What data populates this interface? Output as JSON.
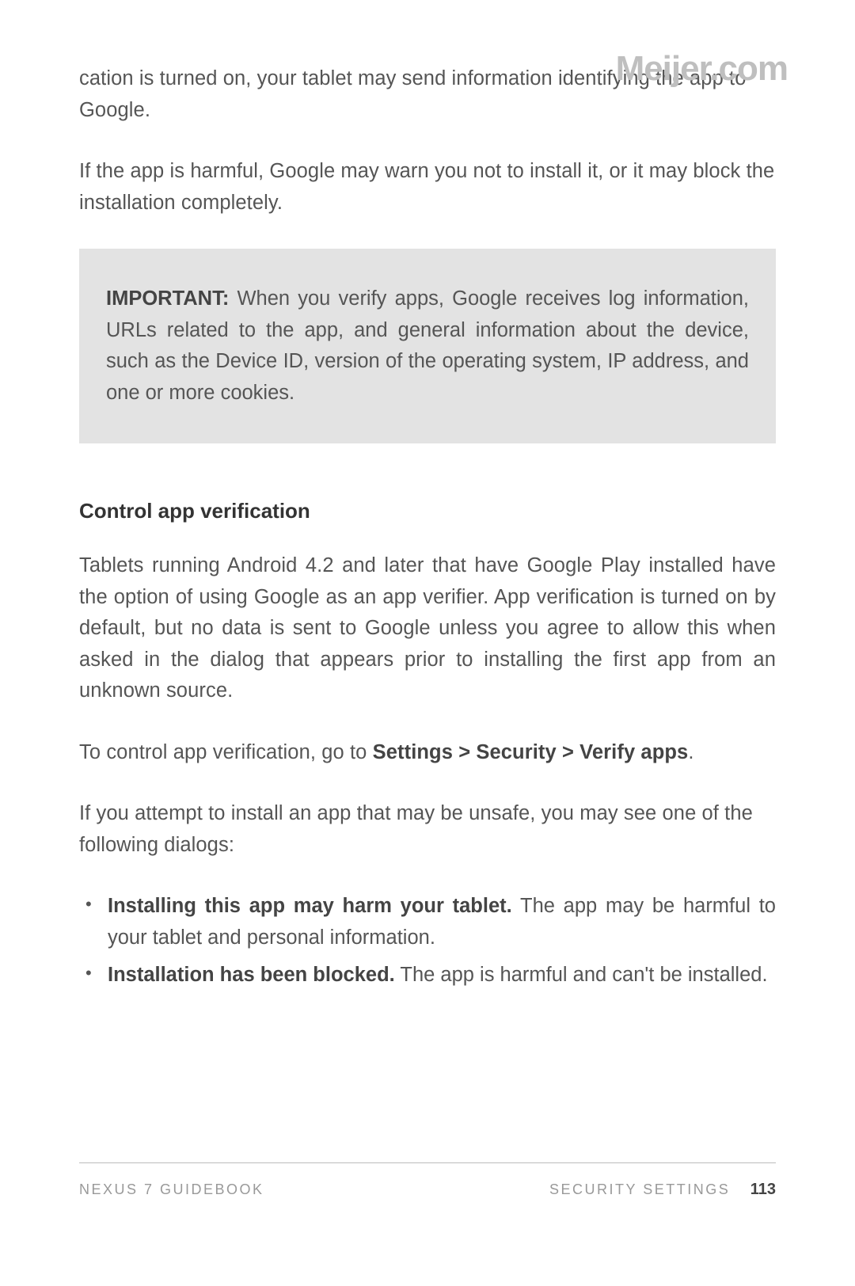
{
  "watermark": "Meijer.com",
  "intro_para1": "cation is turned on, your tablet may send information identifying the app to Google.",
  "intro_para2": "If the app is harmful, Google may warn you not to install it, or it may block the installation completely.",
  "callout_label": "IMPORTANT:",
  "callout_body": " When you verify apps, Google receives log information, URLs related to the app, and general information about the device, such as the Device ID, version of the operating system, IP address, and one or more cookies.",
  "section_heading": "Control app verification",
  "section_para1": "Tablets running Android 4.2 and later that have Google Play installed have the option of using Google as an app verifier. App verification is turned on by default, but no data is sent to Google unless you agree to allow this when asked in the dialog that appears prior to installing the first app from an unknown source.",
  "section_para2_pre": "To control app verification, go to ",
  "section_para2_strong": "Settings > Security > Verify apps",
  "section_para2_post": ".",
  "section_para3": "If you attempt to install an app that may be unsafe, you may see one of the following dialogs:",
  "bullets": [
    {
      "strong": "Installing this app may harm your tablet.",
      "rest": " The app may be harmful to your tablet and personal information."
    },
    {
      "strong": "Installation has been blocked.",
      "rest": " The app is harmful and can't be installed."
    }
  ],
  "footer_left": "NEXUS 7 GUIDEBOOK",
  "footer_right_label": "SECURITY SETTINGS",
  "footer_page": "113"
}
